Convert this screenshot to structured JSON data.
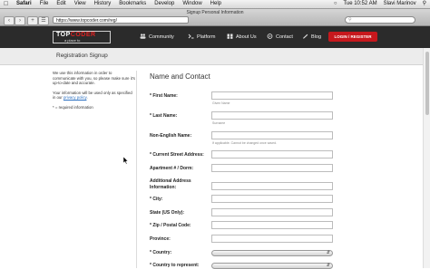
{
  "menubar": {
    "apple": "",
    "menus": [
      "Safari",
      "File",
      "Edit",
      "View",
      "History",
      "Bookmarks",
      "Develop",
      "Window",
      "Help"
    ],
    "time": "Tue 10:52 AM",
    "user": "Slavi Marinov"
  },
  "browser": {
    "window_title": "Signup Personal Information",
    "url": "https://www.topcoder.com/reg/",
    "back": "‹",
    "forward": "›"
  },
  "site": {
    "logo_top": "TOP",
    "logo_red": "CODER",
    "logo_tagline": "a place to",
    "nav": [
      {
        "label": "Community",
        "icon": "people-icon"
      },
      {
        "label": "Platform",
        "icon": "platform-icon"
      },
      {
        "label": "About Us",
        "icon": "info-icon"
      },
      {
        "label": "Contact",
        "icon": "contact-icon"
      },
      {
        "label": "Blog",
        "icon": "blog-icon"
      }
    ],
    "login_label": "LOGIN / REGISTER",
    "accent": "#c7181d"
  },
  "page": {
    "title": "Registration Signup",
    "sidebar_p1": "We use this information in order to communicate with you, so please make sure it's up-to-date and accurate.",
    "sidebar_p2_prefix": "Your information will be used only as specified in our ",
    "sidebar_p2_link": "privacy policy",
    "sidebar_p2_suffix": ".",
    "sidebar_p3": "* = required information",
    "section_title": "Name and Contact",
    "fields": {
      "first_name": "* First Name:",
      "first_name_hint": "Given Name",
      "last_name": "* Last Name:",
      "last_name_hint": "Surname",
      "non_english": "Non-English Name:",
      "non_english_hint": "If applicable. Cannot be changed once saved.",
      "street": "* Current Street Address:",
      "apartment": "Apartment # / Dorm:",
      "additional": "Additional Address",
      "additional2": "Information:",
      "city": "* City:",
      "state": "State (US Only):",
      "zip": "* Zip / Postal Code:",
      "province": "Province:",
      "country": "* Country:",
      "country_rep": "* Country to represent:"
    }
  }
}
